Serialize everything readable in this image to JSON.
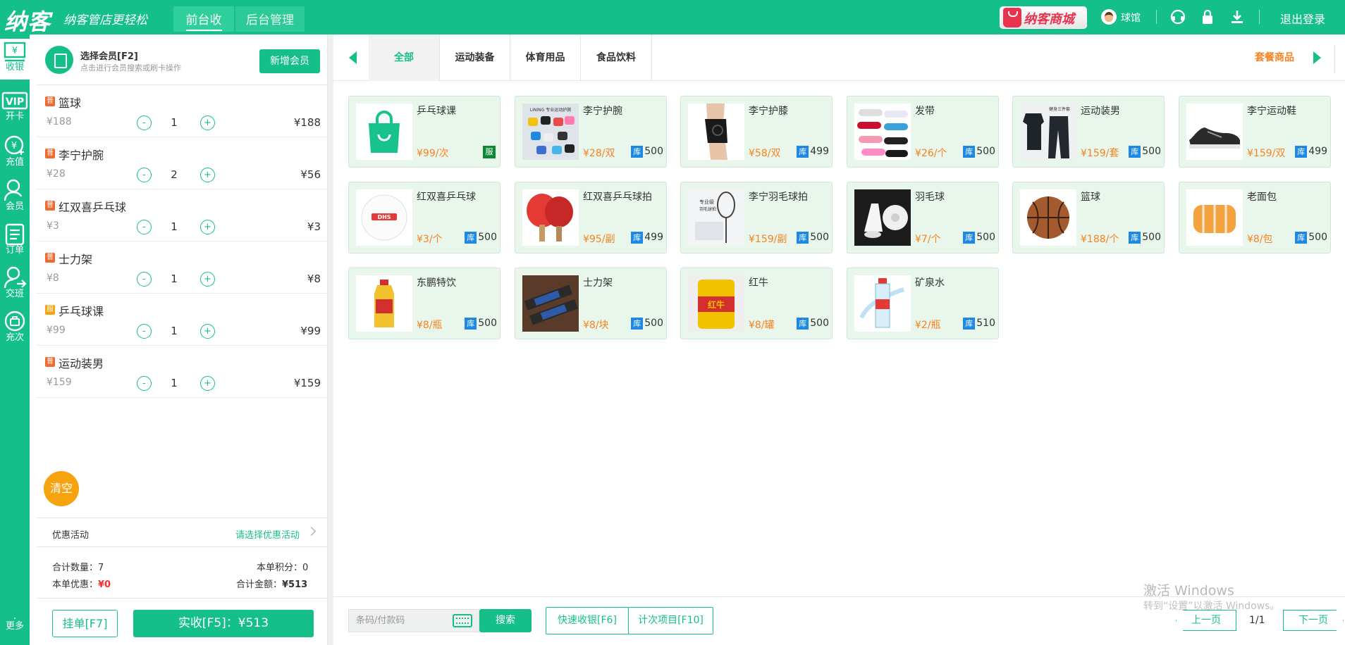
{
  "header": {
    "logo": "纳客",
    "slogan": "纳客管店更轻松",
    "tabs": [
      "前台收银",
      "后台管理"
    ],
    "mall": "纳客商城",
    "user": "球馆",
    "logout": "退出登录"
  },
  "nav": {
    "items": [
      "收银",
      "开卡",
      "充值",
      "会员",
      "订单",
      "交班",
      "充次",
      "更多"
    ],
    "vip_text": "VIP"
  },
  "member": {
    "title": "选择会员[F2]",
    "hint": "点击进行会员搜索或刷卡操作",
    "add_button": "新增会员"
  },
  "cart": {
    "items": [
      {
        "tag": "普",
        "tag_color": "#ef6a2d",
        "name": "篮球",
        "price": "¥188",
        "qty": "1",
        "subtotal": "¥188"
      },
      {
        "tag": "普",
        "tag_color": "#ef6a2d",
        "name": "李宁护腕",
        "price": "¥28",
        "qty": "2",
        "subtotal": "¥56"
      },
      {
        "tag": "普",
        "tag_color": "#ef6a2d",
        "name": "红双喜乒乓球",
        "price": "¥3",
        "qty": "1",
        "subtotal": "¥3"
      },
      {
        "tag": "普",
        "tag_color": "#ef6a2d",
        "name": "士力架",
        "price": "¥8",
        "qty": "1",
        "subtotal": "¥8"
      },
      {
        "tag": "服",
        "tag_color": "#f7a20f",
        "name": "乒乓球课",
        "price": "¥99",
        "qty": "1",
        "subtotal": "¥99"
      },
      {
        "tag": "普",
        "tag_color": "#ef6a2d",
        "name": "运动装男",
        "price": "¥159",
        "qty": "1",
        "subtotal": "¥159"
      }
    ],
    "minus": "-",
    "plus": "+",
    "clear": "清空",
    "promo_label": "优惠活动",
    "promo_select": "请选择优惠活动",
    "total_qty_label": "合计数量：",
    "total_qty": "7",
    "points_label": "本单积分：",
    "points": "0",
    "discount_label": "本单优惠：",
    "discount": "¥0",
    "total_label": "合计金额：",
    "total": "¥513",
    "hold_button": "挂单[F7]",
    "pay_button": "实收[F5]：¥513"
  },
  "categories": {
    "tabs": [
      "全部",
      "运动装备",
      "体育用品",
      "食品饮料"
    ],
    "combo": "套餐商品"
  },
  "products": [
    {
      "name": "乒乓球课",
      "price": "¥99/次",
      "stock": "",
      "badge": "服",
      "icon": "shopping-bag"
    },
    {
      "name": "李宁护腕",
      "price": "¥28/双",
      "stock": "500",
      "badge": "库",
      "icon": "wristband"
    },
    {
      "name": "李宁护膝",
      "price": "¥58/双",
      "stock": "499",
      "badge": "库",
      "icon": "knee-pad"
    },
    {
      "name": "发带",
      "price": "¥26/个",
      "stock": "500",
      "badge": "库",
      "icon": "headband"
    },
    {
      "name": "运动装男",
      "price": "¥159/套",
      "stock": "500",
      "badge": "库",
      "icon": "sportswear"
    },
    {
      "name": "李宁运动鞋",
      "price": "¥159/双",
      "stock": "499",
      "badge": "库",
      "icon": "sneaker"
    },
    {
      "name": "红双喜乒乓球",
      "price": "¥3/个",
      "stock": "500",
      "badge": "库",
      "icon": "ping-pong-ball"
    },
    {
      "name": "红双喜乒乓球拍",
      "price": "¥95/副",
      "stock": "499",
      "badge": "库",
      "icon": "paddle"
    },
    {
      "name": "李宁羽毛球拍",
      "price": "¥159/副",
      "stock": "500",
      "badge": "库",
      "icon": "racket"
    },
    {
      "name": "羽毛球",
      "price": "¥7/个",
      "stock": "500",
      "badge": "库",
      "icon": "shuttlecock"
    },
    {
      "name": "篮球",
      "price": "¥188/个",
      "stock": "500",
      "badge": "库",
      "icon": "basketball"
    },
    {
      "name": "老面包",
      "price": "¥8/包",
      "stock": "500",
      "badge": "库",
      "icon": "bread"
    },
    {
      "name": "东鹏特饮",
      "price": "¥8/瓶",
      "stock": "500",
      "badge": "库",
      "icon": "drink-bottle"
    },
    {
      "name": "士力架",
      "price": "¥8/块",
      "stock": "500",
      "badge": "库",
      "icon": "candy-bar"
    },
    {
      "name": "红牛",
      "price": "¥8/罐",
      "stock": "500",
      "badge": "库",
      "icon": "can"
    },
    {
      "name": "矿泉水",
      "price": "¥2/瓶",
      "stock": "510",
      "badge": "库",
      "icon": "water-bottle"
    }
  ],
  "image_labels": {
    "knee_pad_text": "健身三件套",
    "racket_text1": "专业级",
    "racket_text2": "羽毛球拍",
    "can_text": "红牛",
    "wristband_text": "LINING 专业运动护腕",
    "ball_text": "DHS"
  },
  "bottom": {
    "barcode_placeholder": "条码/付款码",
    "search_button": "搜索",
    "quick_button": "快速收银[F6]",
    "count_button": "计次项目[F10]",
    "prev": "上一页",
    "page": "1/1",
    "next": "下一页",
    "win1": "激活 Windows",
    "win2": "转到“设置”以激活 Windows。"
  },
  "colors": {
    "brand": "#15bf8a",
    "price": "#f7831f",
    "stock_badge": "#1e88e5",
    "service_badge": "#0a8a32"
  }
}
